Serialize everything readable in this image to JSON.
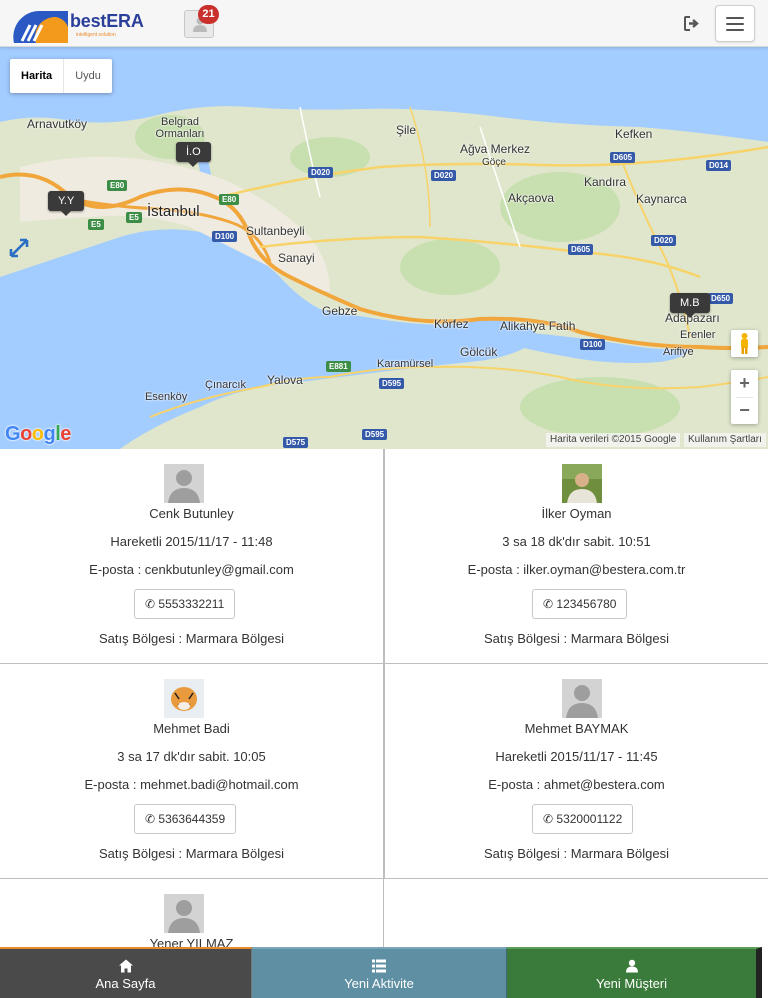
{
  "header": {
    "brand": "bestERA",
    "brand_tagline": "intelligent solution",
    "notification_count": "21",
    "icons": {
      "notification": "user-icon",
      "logout": "sign-out-icon",
      "menu": "hamburger-icon"
    }
  },
  "map": {
    "map_type": {
      "map": "Harita",
      "satellite": "Uydu",
      "selected": "Harita"
    },
    "markers": [
      "İ.O",
      "Y.Y",
      "M.B"
    ],
    "place_labels": [
      "Arnavutköy",
      "Belgrad Ormanları",
      "Şile",
      "Ağva Merkez",
      "Göçe",
      "Kefken",
      "Kandıra",
      "Akçaova",
      "Kaynarca",
      "İstanbul",
      "Sultanbeyli",
      "Sanayi",
      "Gebze",
      "Körfez",
      "Alikahya Fatih",
      "Adapazarı",
      "Erenler",
      "Arifiye",
      "Gölcük",
      "Karamürsel",
      "Yalova",
      "Çınarcık",
      "Esenköy"
    ],
    "road_labels": [
      "E80",
      "E80",
      "E5",
      "E5",
      "D020",
      "D020",
      "D020",
      "D605",
      "D014",
      "D100",
      "D605",
      "D100",
      "E881",
      "D595",
      "D595",
      "D575",
      "D650"
    ],
    "attribution": "Harita verileri ©2015 Google",
    "terms": "Kullanım Şartları",
    "google_logo": "Google"
  },
  "cards": [
    {
      "name": "Cenk Butunley",
      "status": "Hareketli 2015/11/17 - 11:48",
      "email": "E-posta : cenkbutunley@gmail.com",
      "phone": "5553332211",
      "region": "Satış Bölgesi : Marmara Bölgesi",
      "avatar": "default-avatar"
    },
    {
      "name": "İlker Oyman",
      "status": "3 sa 18 dk'dır sabit. 10:51",
      "email": "E-posta : ilker.oyman@bestera.com.tr",
      "phone": "123456780",
      "region": "Satış Bölgesi : Marmara Bölgesi",
      "avatar": "photo-avatar"
    },
    {
      "name": "Mehmet Badi",
      "status": "3 sa 17 dk'dır sabit. 10:05",
      "email": "E-posta : mehmet.badi@hotmail.com",
      "phone": "5363644359",
      "region": "Satış Bölgesi : Marmara Bölgesi",
      "avatar": "tiger-avatar"
    },
    {
      "name": "Mehmet BAYMAK",
      "status": "Hareketli 2015/11/17 - 11:45",
      "email": "E-posta : ahmet@bestera.com",
      "phone": "5320001122",
      "region": "Satış Bölgesi : Marmara Bölgesi",
      "avatar": "default-avatar"
    },
    {
      "name": "Yener YILMAZ",
      "avatar": "default-avatar"
    }
  ],
  "bottom_nav": [
    {
      "label": "Ana Sayfa",
      "icon": "home-icon",
      "color": "#4a4a4a"
    },
    {
      "label": "Yeni Aktivite",
      "icon": "list-icon",
      "color": "#5f8fa3"
    },
    {
      "label": "Yeni Müşteri",
      "icon": "user-icon",
      "color": "#3a7a3a"
    }
  ],
  "colors": {
    "accent": "#e68a2a",
    "badge": "#c9302c",
    "brand": "#2a3f99"
  }
}
